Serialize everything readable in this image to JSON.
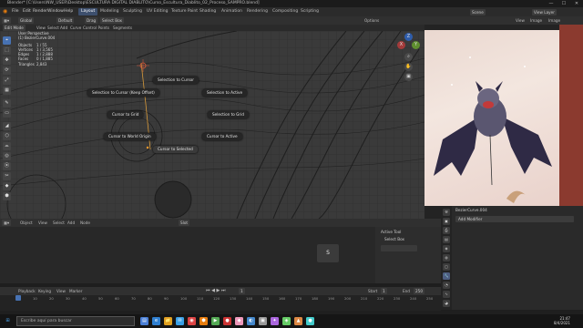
{
  "window": {
    "title": "Blender* [C:\\Users\\NW_USER\\Desktop\\ESCULTURA DIGITAL DIABLITO\\Curso_Escultura_Diablito_02_Proceso_SAMPRO.blend]",
    "controls": [
      "—",
      "☐",
      "✕"
    ]
  },
  "menubar": {
    "items": [
      "File",
      "Edit",
      "Render",
      "Window",
      "Help"
    ],
    "workspaces": [
      "Layout",
      "Modeling",
      "Sculpting",
      "UV Editing",
      "Texture Paint",
      "Shading",
      "Animation",
      "Rendering",
      "Compositing",
      "Scripting"
    ],
    "active_workspace": "Layout",
    "scene": "Scene",
    "view_layer": "View Layer"
  },
  "viewport_header": {
    "orientation": "Global",
    "pivot": "Default",
    "drag": "Drag",
    "select_box": "Select Box",
    "edit_mode": "Edit Mode",
    "menus": [
      "View",
      "Select",
      "Add",
      "Curve",
      "Control Points",
      "Segments"
    ],
    "options": "Options"
  },
  "stats": {
    "view": "User Perspective",
    "object_name": "(1) BezierCurve.004",
    "rows": [
      {
        "label": "Objects",
        "value": "1 / 55"
      },
      {
        "label": "Vertices",
        "value": "1 / 3,565"
      },
      {
        "label": "Edges",
        "value": "1 / 2,888"
      },
      {
        "label": "Faces",
        "value": "0 / 1,885"
      },
      {
        "label": "Triangles",
        "value": "2,843"
      }
    ]
  },
  "pie_menu": {
    "items": [
      "Selection to Cursor",
      "Selection to Cursor (Keep Offset)",
      "Selection to Active",
      "Cursor to Grid",
      "Selection to Grid",
      "Cursor to World Origin",
      "Cursor to Active",
      "Cursor to Selected"
    ]
  },
  "gizmo": {
    "axes": [
      "Z",
      "X",
      "Y"
    ]
  },
  "tools": [
    "⌖",
    "⬚",
    "✥",
    "⟳",
    "⤢",
    "▦",
    "✎",
    "▭",
    "◢",
    "⬡",
    "⌓",
    "◎",
    "⦿",
    "✂",
    "◆",
    "⬢"
  ],
  "reference_panel": {
    "header_items": [
      "View",
      "Image",
      "Image"
    ],
    "name": "Diablito_ref"
  },
  "properties": {
    "object": "BezierCurve.004",
    "modifier_button": "Add Modifier"
  },
  "sequencer": {
    "menus": [
      "Object",
      "View",
      "Select",
      "Add",
      "Node"
    ],
    "key_label": "S",
    "active_tool_title": "Active Tool",
    "active_tool_value": "Select Box",
    "slot": "Slot"
  },
  "timeline": {
    "menus": [
      "Playback",
      "Keying",
      "View",
      "Marker"
    ],
    "current_frame": "1",
    "start_label": "Start",
    "start": "1",
    "end_label": "End",
    "end": "250",
    "ticks": [
      "0",
      "10",
      "20",
      "30",
      "40",
      "50",
      "60",
      "70",
      "80",
      "90",
      "100",
      "110",
      "120",
      "130",
      "140",
      "150",
      "160",
      "170",
      "180",
      "190",
      "200",
      "210",
      "220",
      "230",
      "240",
      "250"
    ]
  },
  "status_bar": {
    "left": "Select",
    "middle": "Rotate View",
    "right": "Object"
  },
  "taskbar": {
    "search_placeholder": "Escribe aquí para buscar",
    "time": "21:47",
    "date": "8/4/2021",
    "apps": [
      "⊞",
      "▤",
      "e",
      "📁",
      "✉",
      "◉",
      "⬢",
      "▶",
      "●",
      "◆",
      "◐",
      "▣",
      "✦",
      "◈",
      "▲",
      "●"
    ]
  },
  "colors": {
    "accent": "#4772b3",
    "viewport_bg": "#3a3a3a",
    "header_bg": "#303030"
  }
}
